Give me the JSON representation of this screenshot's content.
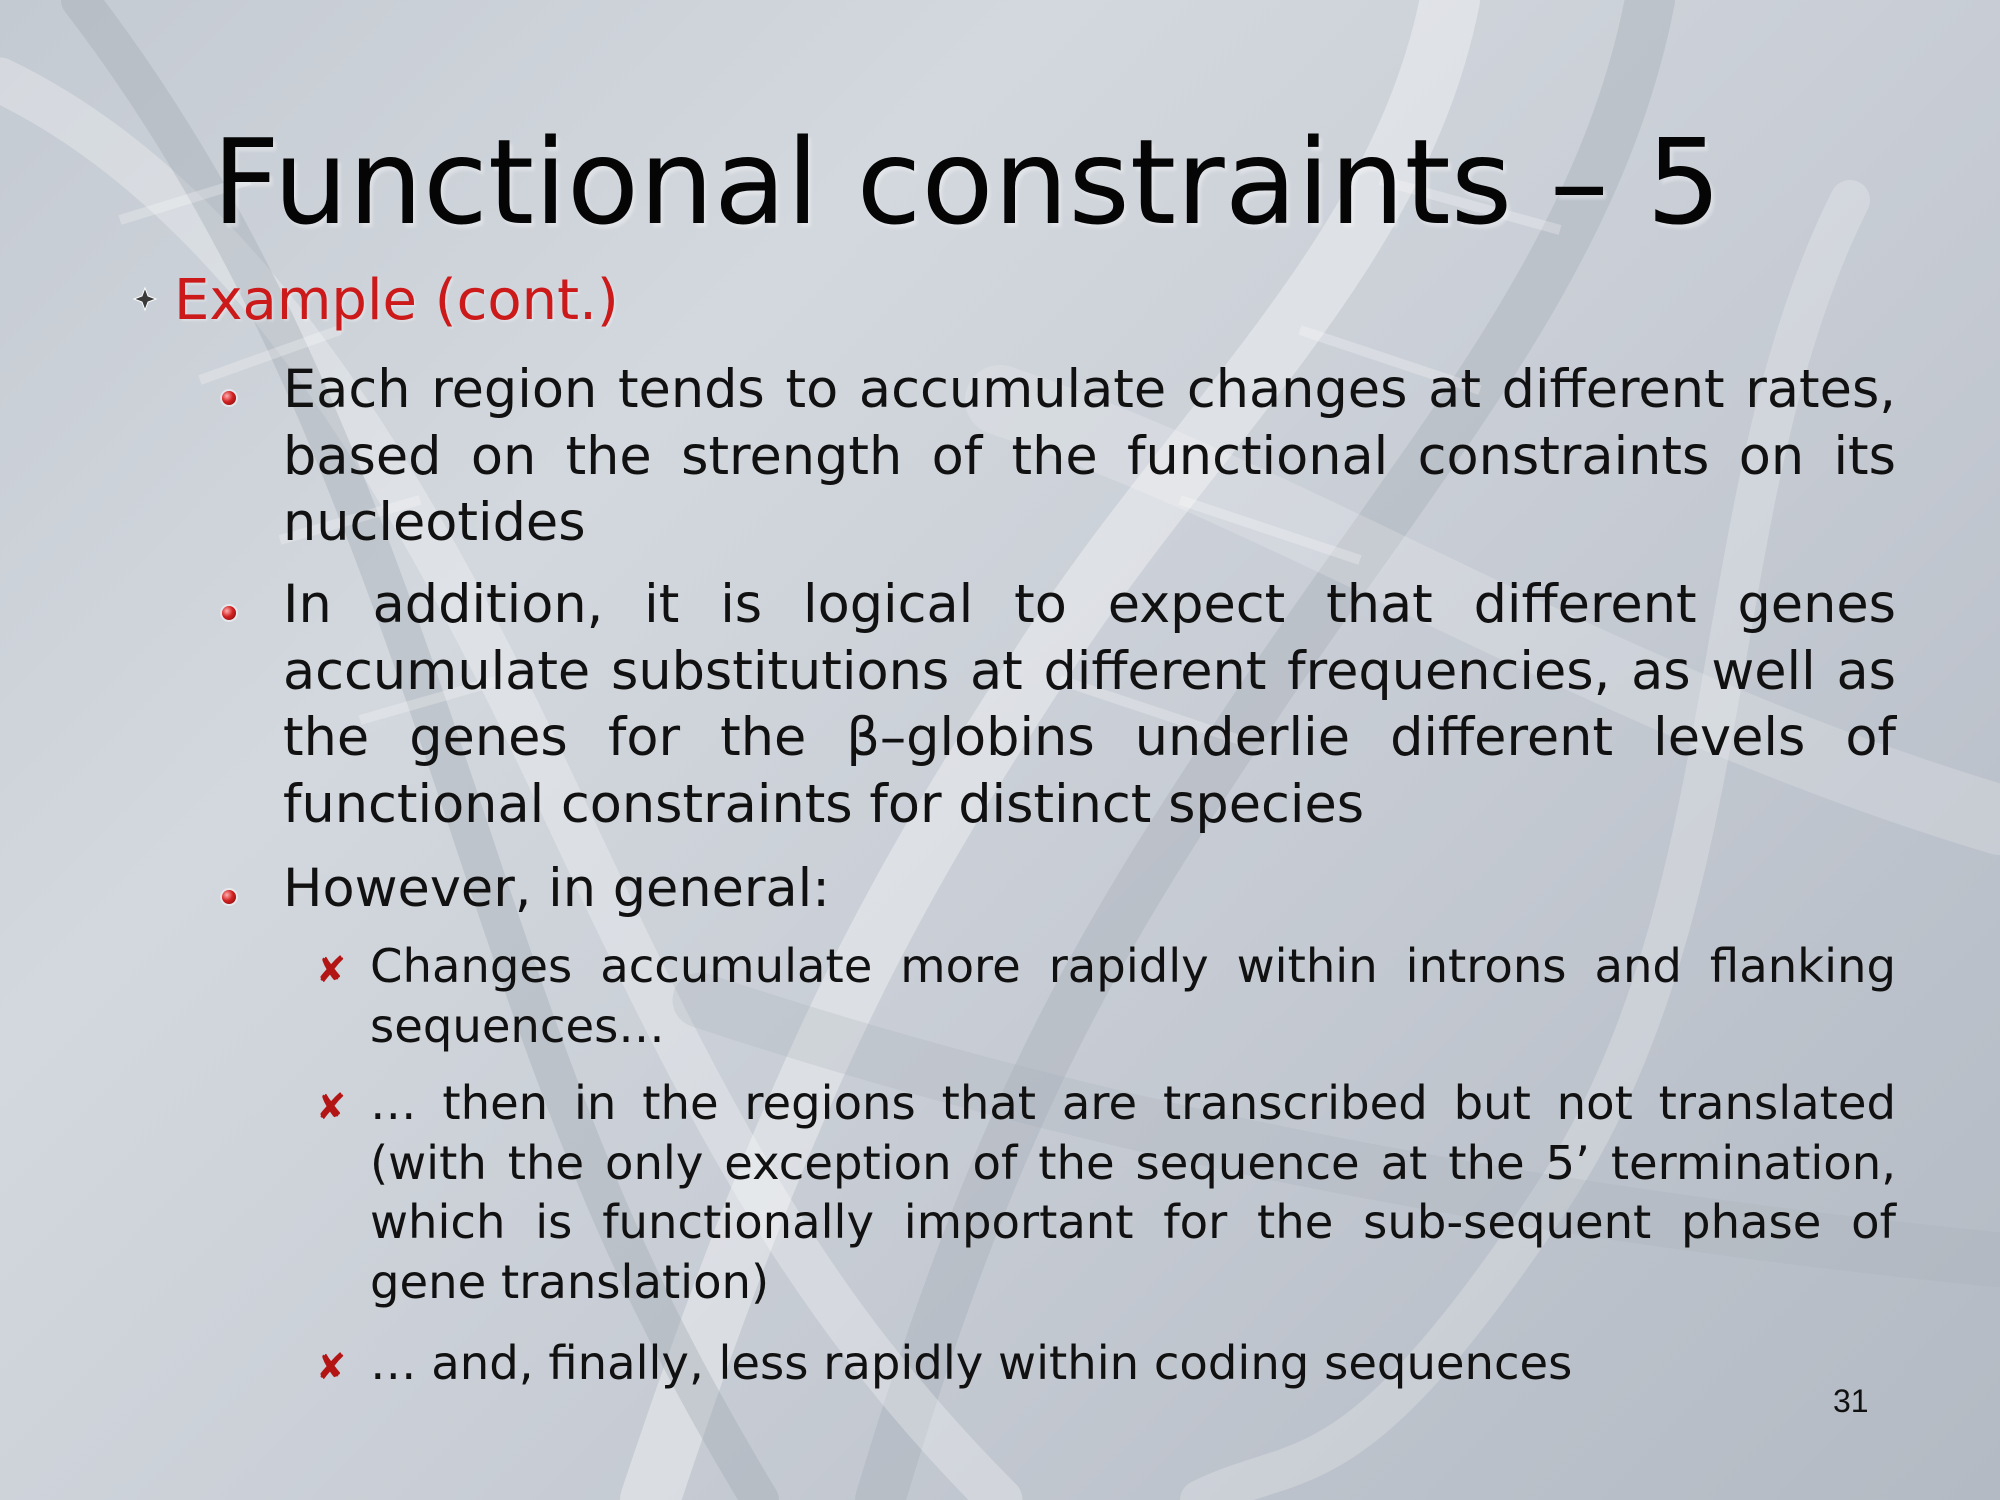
{
  "slide": {
    "title": "Functional constraints – 5",
    "level1": "Example (cont.)",
    "bullets": [
      "Each region tends to accumulate changes at different rates, based on the strength of the functional constraints on its nucleotides",
      "In addition, it is logical to expect that different genes accumulate substitutions at different frequencies, as well as the genes for the β–globins underlie different levels of functional constraints for distinct species",
      "However, in general:"
    ],
    "subbullets": [
      "Changes accumulate more rapidly within introns and flanking sequences…",
      "… then in the regions that are transcribed but not translated (with the only exception of the sequence at the 5’ termination, which is functionally important for the sub-sequent phase of gene translation)",
      "… and, finally, less rapidly within coding sequences"
    ],
    "page_number": "31"
  },
  "colors": {
    "title": "#050505",
    "level1_text": "#cc1a1a",
    "bullet_red": "#b31414",
    "body_text": "#111111"
  },
  "icons": {
    "level1_bullet": "diamond-star-icon",
    "level2_bullet": "red-ball-icon",
    "level3_bullet": "x-mark-icon"
  }
}
